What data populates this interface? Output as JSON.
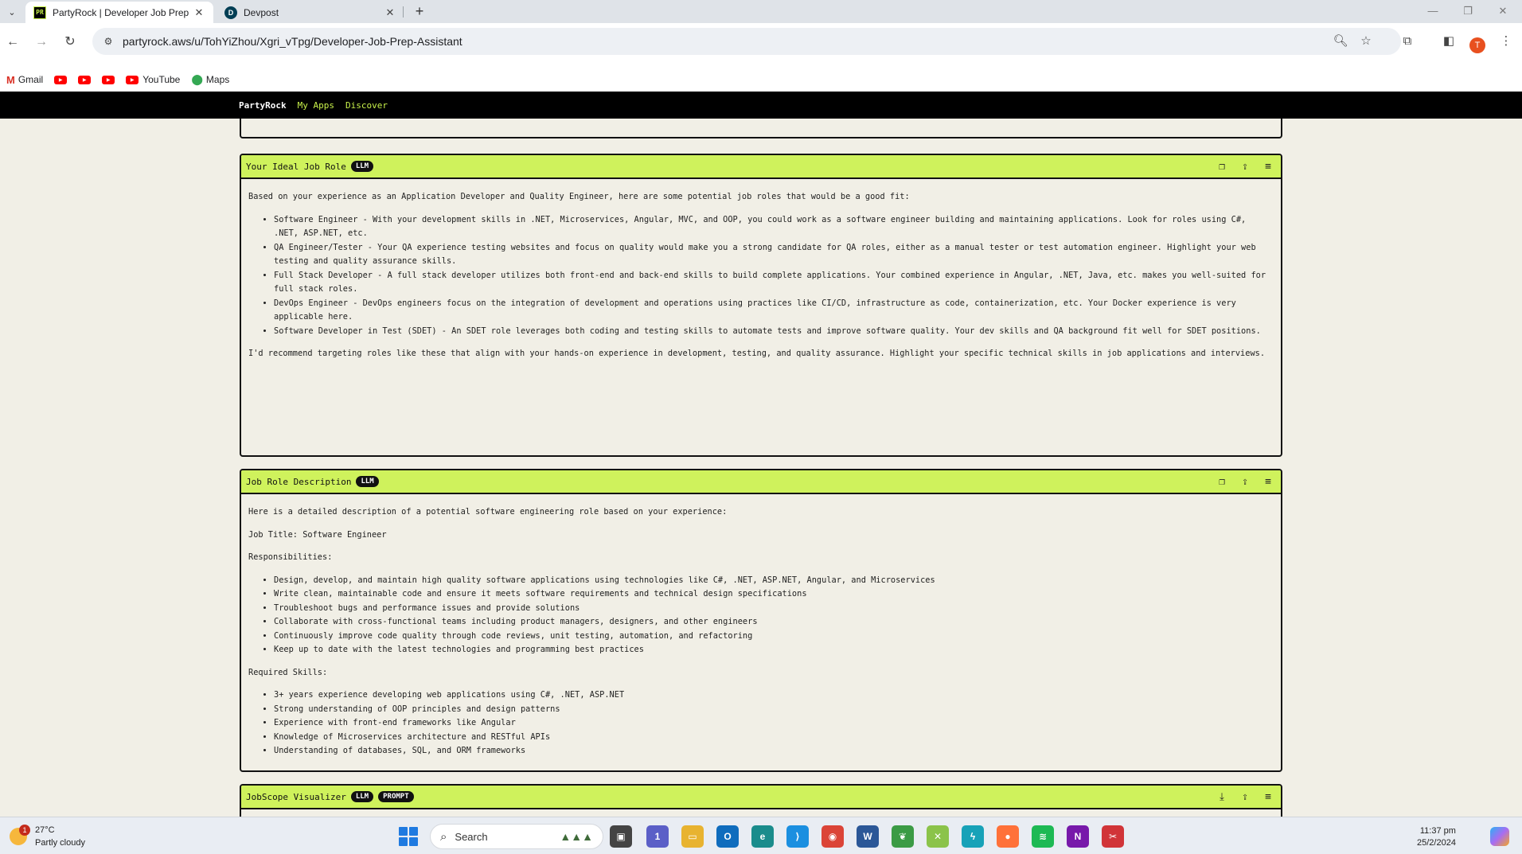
{
  "browser": {
    "tabs": [
      {
        "favicon": "PR",
        "title": "PartyRock | Developer Job Prep",
        "active": true
      },
      {
        "favicon": "D",
        "title": "Devpost",
        "active": false
      }
    ],
    "tab_close": "✕",
    "new_tab": "+",
    "window_controls": {
      "minimize": "—",
      "restore": "❐",
      "close": "✕"
    },
    "url": "partyrock.aws/u/TohYiZhou/Xgri_vTpg/Developer-Job-Prep-Assistant",
    "profile_initial": "T",
    "bookmarks": [
      {
        "icon": "gmail-icon",
        "label": "Gmail"
      },
      {
        "icon": "youtube-icon",
        "label": ""
      },
      {
        "icon": "youtube-icon",
        "label": ""
      },
      {
        "icon": "youtube-icon",
        "label": ""
      },
      {
        "icon": "youtube-icon",
        "label": "YouTube"
      },
      {
        "icon": "maps-icon",
        "label": "Maps"
      }
    ]
  },
  "partyrock": {
    "brand": "PartyRock",
    "nav_links": [
      "My Apps",
      "Discover"
    ],
    "widgets": [
      {
        "title": "Your Ideal Job Role",
        "badges": [
          "LLM"
        ],
        "intro": "Based on your experience as an Application Developer and Quality Engineer, here are some potential job roles that would be a good fit:",
        "items": [
          "Software Engineer - With your development skills in .NET, Microservices, Angular, MVC, and OOP, you could work as a software engineer building and maintaining applications. Look for roles using C#, .NET, ASP.NET, etc.",
          "QA Engineer/Tester - Your QA experience testing websites and focus on quality would make you a strong candidate for QA roles, either as a manual tester or test automation engineer. Highlight your web testing and quality assurance skills.",
          "Full Stack Developer - A full stack developer utilizes both front-end and back-end skills to build complete applications. Your combined experience in Angular, .NET, Java, etc. makes you well-suited for full stack roles.",
          "DevOps Engineer - DevOps engineers focus on the integration of development and operations using practices like CI/CD, infrastructure as code, containerization, etc. Your Docker experience is very applicable here.",
          "Software Developer in Test (SDET) - An SDET role leverages both coding and testing skills to automate tests and improve software quality. Your dev skills and QA background fit well for SDET positions."
        ],
        "outro": "I'd recommend targeting roles like these that align with your hands-on experience in development, testing, and quality assurance. Highlight your specific technical skills in job applications and interviews."
      },
      {
        "title": "Job Role Description",
        "badges": [
          "LLM"
        ],
        "intro": "Here is a detailed description of a potential software engineering role based on your experience:",
        "job_title": "Job Title: Software Engineer",
        "responsibilities_label": "Responsibilities:",
        "responsibilities": [
          "Design, develop, and maintain high quality software applications using technologies like C#, .NET, ASP.NET, Angular, and Microservices",
          "Write clean, maintainable code and ensure it meets software requirements and technical design specifications",
          "Troubleshoot bugs and performance issues and provide solutions",
          "Collaborate with cross-functional teams including product managers, designers, and other engineers",
          "Continuously improve code quality through code reviews, unit testing, automation, and refactoring",
          "Keep up to date with the latest technologies and programming best practices"
        ],
        "skills_label": "Required Skills:",
        "skills": [
          "3+ years experience developing web applications using C#, .NET, ASP.NET",
          "Strong understanding of OOP principles and design patterns",
          "Experience with front-end frameworks like Angular",
          "Knowledge of Microservices architecture and RESTful APIs",
          "Understanding of databases, SQL, and ORM frameworks"
        ]
      },
      {
        "title": "JobScope Visualizer",
        "badges": [
          "LLM",
          "PROMPT"
        ]
      }
    ]
  },
  "taskbar": {
    "weather_temp": "27°C",
    "weather_desc": "Partly cloudy",
    "weather_notifications": "1",
    "search_placeholder": "Search",
    "teams_badge": "1",
    "time": "11:37 pm",
    "date": "25/2/2024"
  },
  "colors": {
    "accent": "#cff25c",
    "nav_bg": "#000000",
    "page_bg": "#f1efe6"
  }
}
